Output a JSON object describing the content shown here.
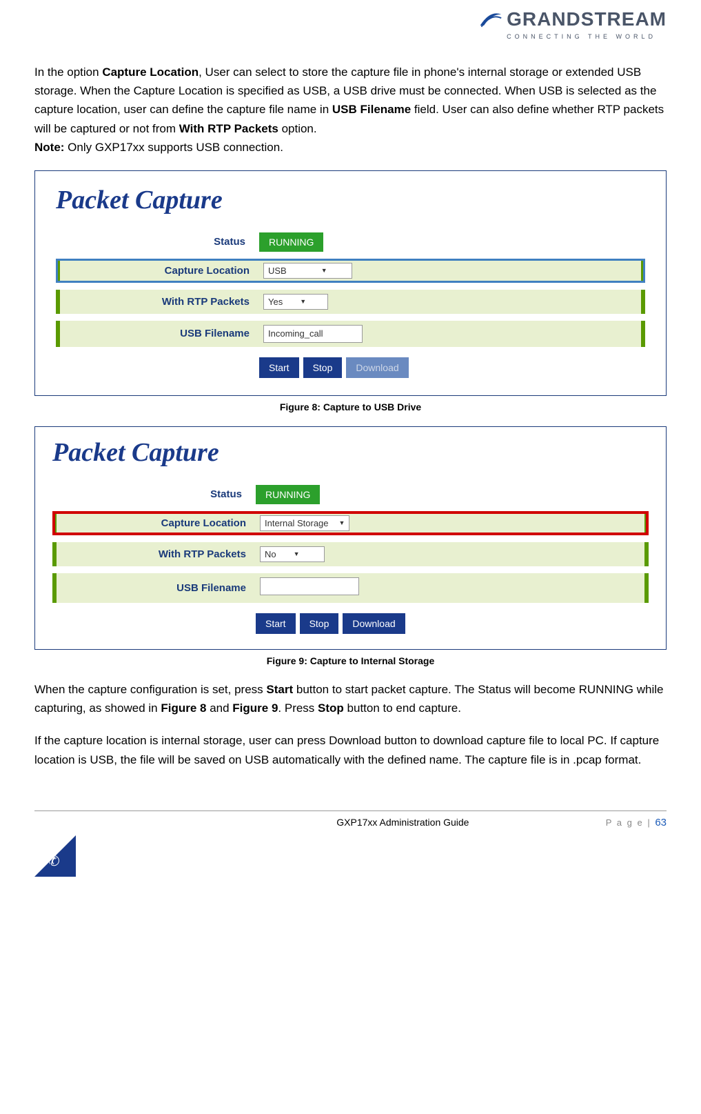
{
  "header": {
    "brand": "GRANDSTREAM",
    "tagline": "CONNECTING THE WORLD"
  },
  "intro": {
    "p1_a": "In the option ",
    "p1_b": "Capture Location",
    "p1_c": ", User can select to store the capture file in phone's internal storage or extended USB storage. When the Capture Location is specified as USB, a USB drive must be connected. When USB is selected as the capture location, user can define the capture file name in ",
    "p1_d": "USB Filename",
    "p1_e": " field. User can also define whether RTP packets will be captured or not from ",
    "p1_f": "With RTP Packets",
    "p1_g": " option.",
    "note_label": "Note:",
    "note_text": " Only GXP17xx supports USB connection."
  },
  "fig8": {
    "title": "Packet Capture",
    "status_label": "Status",
    "status_value": "RUNNING",
    "loc_label": "Capture Location",
    "loc_value": "USB",
    "rtp_label": "With RTP Packets",
    "rtp_value": "Yes",
    "fn_label": "USB Filename",
    "fn_value": "Incoming_call",
    "btn_start": "Start",
    "btn_stop": "Stop",
    "btn_download": "Download",
    "caption": "Figure 8: Capture to USB Drive"
  },
  "fig9": {
    "title": "Packet Capture",
    "status_label": "Status",
    "status_value": "RUNNING",
    "loc_label": "Capture Location",
    "loc_value": "Internal Storage",
    "rtp_label": "With RTP Packets",
    "rtp_value": "No",
    "fn_label": "USB Filename",
    "fn_value": "",
    "btn_start": "Start",
    "btn_stop": "Stop",
    "btn_download": "Download",
    "caption": "Figure 9: Capture to Internal Storage"
  },
  "outro": {
    "p1_a": "When the capture configuration is set, press ",
    "p1_b": "Start",
    "p1_c": " button to start packet capture. The Status will become RUNNING while capturing, as showed in ",
    "p1_d": "Figure 8",
    "p1_e": " and ",
    "p1_f": "Figure 9",
    "p1_g": ". Press ",
    "p1_h": "Stop",
    "p1_i": " button to end capture.",
    "p2": "If the capture location is internal storage, user can press Download button to download capture file to local PC. If capture location is USB, the file will be saved on USB automatically with the defined name. The capture file is in .pcap format."
  },
  "footer": {
    "guide": "GXP17xx Administration Guide",
    "page_prefix": "P a g e  | ",
    "page_num": "63"
  }
}
